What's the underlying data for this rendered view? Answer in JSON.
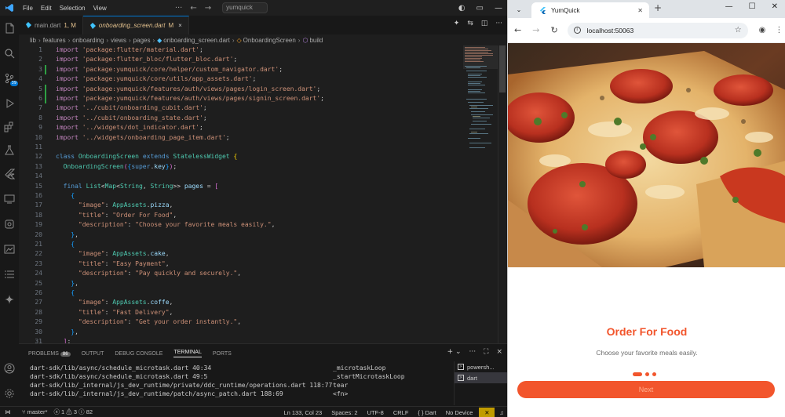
{
  "vscode": {
    "menu": [
      "File",
      "Edit",
      "Selection",
      "View"
    ],
    "search_text": "yumquick",
    "tabs": [
      {
        "label": "main.dart",
        "status": "1, M"
      },
      {
        "label": "onboarding_screen.dart",
        "status": "M"
      }
    ],
    "breadcrumb": [
      "lib",
      "features",
      "onboarding",
      "views",
      "pages",
      "onboarding_screen.dart",
      "OnboardingScreen",
      "build"
    ],
    "source_control_badge": "39",
    "code_lines": [
      {
        "n": "1",
        "segs": [
          [
            "kw",
            "import"
          ],
          [
            "pun",
            " "
          ],
          [
            "str",
            "'package:flutter/material.dart'"
          ],
          [
            "pun",
            ";"
          ]
        ]
      },
      {
        "n": "2",
        "segs": [
          [
            "kw",
            "import"
          ],
          [
            "pun",
            " "
          ],
          [
            "str",
            "'package:flutter_bloc/flutter_bloc.dart'"
          ],
          [
            "pun",
            ";"
          ]
        ]
      },
      {
        "n": "3",
        "segs": [
          [
            "kw",
            "import"
          ],
          [
            "pun",
            " "
          ],
          [
            "str",
            "'package:yumquick/core/helper/custom_navigator.dart'"
          ],
          [
            "pun",
            ";"
          ]
        ],
        "mark": true
      },
      {
        "n": "4",
        "segs": [
          [
            "kw",
            "import"
          ],
          [
            "pun",
            " "
          ],
          [
            "str",
            "'package:yumquick/core/utils/app_assets.dart'"
          ],
          [
            "pun",
            ";"
          ]
        ]
      },
      {
        "n": "5",
        "segs": [
          [
            "kw",
            "import"
          ],
          [
            "pun",
            " "
          ],
          [
            "str",
            "'package:yumquick/features/auth/views/pages/login_screen.dart'"
          ],
          [
            "pun",
            ";"
          ]
        ],
        "mark": true
      },
      {
        "n": "6",
        "segs": [
          [
            "kw",
            "import"
          ],
          [
            "pun",
            " "
          ],
          [
            "str",
            "'package:yumquick/features/auth/views/pages/signin_screen.dart'"
          ],
          [
            "pun",
            ";"
          ]
        ],
        "mark": true
      },
      {
        "n": "7",
        "segs": [
          [
            "kw",
            "import"
          ],
          [
            "pun",
            " "
          ],
          [
            "str",
            "'../cubit/onboarding_cubit.dart'"
          ],
          [
            "pun",
            ";"
          ]
        ]
      },
      {
        "n": "8",
        "segs": [
          [
            "kw",
            "import"
          ],
          [
            "pun",
            " "
          ],
          [
            "str",
            "'../cubit/onboarding_state.dart'"
          ],
          [
            "pun",
            ";"
          ]
        ]
      },
      {
        "n": "9",
        "segs": [
          [
            "kw",
            "import"
          ],
          [
            "pun",
            " "
          ],
          [
            "str",
            "'../widgets/dot_indicator.dart'"
          ],
          [
            "pun",
            ";"
          ]
        ]
      },
      {
        "n": "10",
        "segs": [
          [
            "kw",
            "import"
          ],
          [
            "pun",
            " "
          ],
          [
            "str",
            "'../widgets/onboarding_page_item.dart'"
          ],
          [
            "pun",
            ";"
          ]
        ]
      },
      {
        "n": "11",
        "segs": []
      },
      {
        "n": "12",
        "segs": [
          [
            "kw2",
            "class"
          ],
          [
            "pun",
            " "
          ],
          [
            "cls",
            "OnboardingScreen"
          ],
          [
            "pun",
            " "
          ],
          [
            "kw2",
            "extends"
          ],
          [
            "pun",
            " "
          ],
          [
            "cls",
            "StatelessWidget"
          ],
          [
            "pun",
            " "
          ],
          [
            "b1",
            "{"
          ]
        ]
      },
      {
        "n": "13",
        "segs": [
          [
            "pun",
            "  "
          ],
          [
            "cls",
            "OnboardingScreen"
          ],
          [
            "b2",
            "("
          ],
          [
            "b3",
            "{"
          ],
          [
            "kw2",
            "super"
          ],
          [
            "pun",
            "."
          ],
          [
            "var",
            "key"
          ],
          [
            "b3",
            "}"
          ],
          [
            "b2",
            ")"
          ],
          [
            "pun",
            ";"
          ]
        ]
      },
      {
        "n": "14",
        "segs": []
      },
      {
        "n": "15",
        "segs": [
          [
            "pun",
            "  "
          ],
          [
            "kw2",
            "final"
          ],
          [
            "pun",
            " "
          ],
          [
            "cls",
            "List"
          ],
          [
            "pun",
            "<"
          ],
          [
            "cls",
            "Map"
          ],
          [
            "pun",
            "<"
          ],
          [
            "cls",
            "String"
          ],
          [
            "pun",
            ", "
          ],
          [
            "cls",
            "String"
          ],
          [
            "pun",
            ">> "
          ],
          [
            "var",
            "pages"
          ],
          [
            "pun",
            " = "
          ],
          [
            "b2",
            "["
          ]
        ]
      },
      {
        "n": "16",
        "segs": [
          [
            "pun",
            "    "
          ],
          [
            "b3",
            "{"
          ]
        ]
      },
      {
        "n": "17",
        "segs": [
          [
            "pun",
            "      "
          ],
          [
            "str",
            "\"image\""
          ],
          [
            "pun",
            ": "
          ],
          [
            "cls",
            "AppAssets"
          ],
          [
            "pun",
            "."
          ],
          [
            "var",
            "pizza"
          ],
          [
            "pun",
            ","
          ]
        ]
      },
      {
        "n": "18",
        "segs": [
          [
            "pun",
            "      "
          ],
          [
            "str",
            "\"title\""
          ],
          [
            "pun",
            ": "
          ],
          [
            "str",
            "\"Order For Food\""
          ],
          [
            "pun",
            ","
          ]
        ]
      },
      {
        "n": "19",
        "segs": [
          [
            "pun",
            "      "
          ],
          [
            "str",
            "\"description\""
          ],
          [
            "pun",
            ": "
          ],
          [
            "str",
            "\"Choose your favorite meals easily.\""
          ],
          [
            "pun",
            ","
          ]
        ]
      },
      {
        "n": "20",
        "segs": [
          [
            "pun",
            "    "
          ],
          [
            "b3",
            "}"
          ],
          [
            "pun",
            ","
          ]
        ]
      },
      {
        "n": "21",
        "segs": [
          [
            "pun",
            "    "
          ],
          [
            "b3",
            "{"
          ]
        ]
      },
      {
        "n": "22",
        "segs": [
          [
            "pun",
            "      "
          ],
          [
            "str",
            "\"image\""
          ],
          [
            "pun",
            ": "
          ],
          [
            "cls",
            "AppAssets"
          ],
          [
            "pun",
            "."
          ],
          [
            "var",
            "cake"
          ],
          [
            "pun",
            ","
          ]
        ]
      },
      {
        "n": "23",
        "segs": [
          [
            "pun",
            "      "
          ],
          [
            "str",
            "\"title\""
          ],
          [
            "pun",
            ": "
          ],
          [
            "str",
            "\"Easy Payment\""
          ],
          [
            "pun",
            ","
          ]
        ]
      },
      {
        "n": "24",
        "segs": [
          [
            "pun",
            "      "
          ],
          [
            "str",
            "\"description\""
          ],
          [
            "pun",
            ": "
          ],
          [
            "str",
            "\"Pay quickly and securely.\""
          ],
          [
            "pun",
            ","
          ]
        ]
      },
      {
        "n": "25",
        "segs": [
          [
            "pun",
            "    "
          ],
          [
            "b3",
            "}"
          ],
          [
            "pun",
            ","
          ]
        ]
      },
      {
        "n": "26",
        "segs": [
          [
            "pun",
            "    "
          ],
          [
            "b3",
            "{"
          ]
        ]
      },
      {
        "n": "27",
        "segs": [
          [
            "pun",
            "      "
          ],
          [
            "str",
            "\"image\""
          ],
          [
            "pun",
            ": "
          ],
          [
            "cls",
            "AppAssets"
          ],
          [
            "pun",
            "."
          ],
          [
            "var",
            "coffe"
          ],
          [
            "pun",
            ","
          ]
        ]
      },
      {
        "n": "28",
        "segs": [
          [
            "pun",
            "      "
          ],
          [
            "str",
            "\"title\""
          ],
          [
            "pun",
            ": "
          ],
          [
            "str",
            "\"Fast Delivery\""
          ],
          [
            "pun",
            ","
          ]
        ]
      },
      {
        "n": "29",
        "segs": [
          [
            "pun",
            "      "
          ],
          [
            "str",
            "\"description\""
          ],
          [
            "pun",
            ": "
          ],
          [
            "str",
            "\"Get your order instantly.\""
          ],
          [
            "pun",
            ","
          ]
        ]
      },
      {
        "n": "30",
        "segs": [
          [
            "pun",
            "    "
          ],
          [
            "b3",
            "}"
          ],
          [
            "pun",
            ","
          ]
        ]
      },
      {
        "n": "31",
        "segs": [
          [
            "pun",
            "  "
          ],
          [
            "b2",
            "]"
          ],
          [
            "pun",
            ";"
          ]
        ]
      }
    ],
    "panel": {
      "tabs": [
        "PROBLEMS",
        "OUTPUT",
        "DEBUG CONSOLE",
        "TERMINAL",
        "PORTS"
      ],
      "problems_count": "86",
      "active_tab": "TERMINAL",
      "terminal_lines": [
        {
          "left": "dart-sdk/lib/async/schedule_microtask.dart 40:34",
          "right": "_microtaskLoop"
        },
        {
          "left": "dart-sdk/lib/async/schedule_microtask.dart 49:5",
          "right": "_startMicrotaskLoop"
        },
        {
          "left": "dart-sdk/lib/_internal/js_dev_runtime/private/ddc_runtime/operations.dart 118:77",
          "right": "tear"
        },
        {
          "left": "dart-sdk/lib/_internal/js_dev_runtime/patch/async_patch.dart 188:69",
          "right": "<fn>"
        }
      ],
      "terminals": [
        "powersh...",
        "dart"
      ]
    },
    "status": {
      "branch": "master*",
      "errors": "1",
      "warnings": "3",
      "info": "82",
      "position": "Ln 133, Col 23",
      "spaces": "Spaces: 2",
      "encoding": "UTF-8",
      "eol": "CRLF",
      "language": "Dart",
      "device": "No Device"
    }
  },
  "chrome": {
    "tab_title": "YumQuick",
    "url": "localhost:50063"
  },
  "app": {
    "title": "Order For Food",
    "description": "Choose your favorite meals easily.",
    "next_label": "Next",
    "page_index": 1,
    "page_count": 3,
    "colors": {
      "accent": "#f2552c"
    }
  }
}
